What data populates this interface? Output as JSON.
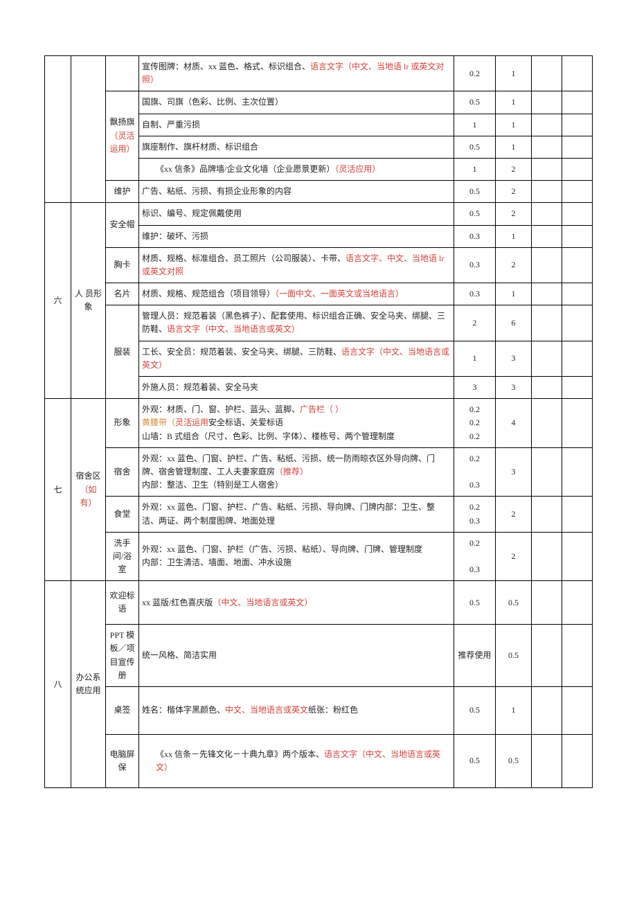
{
  "sec5": {
    "r1": {
      "t1": "宣传图牌：材质、xx 蓝色、格式、标识组合、",
      "t2": "语言文字（中文、当地语 lr 或英文对照）",
      "s1": "0.2",
      "s2": "1"
    },
    "flag_label_a": "飘扬旗",
    "flag_label_b": "（灵活运用）",
    "r2": {
      "desc": "国旗、司旗（色彩、比例、主次位置）",
      "s1": "0.5",
      "s2": "1"
    },
    "r3": {
      "desc": "自制、严重污损",
      "s1": "1",
      "s2": "1"
    },
    "r4": {
      "desc": "旗座制作、旗杆材质、标识组合",
      "s1": "0.5",
      "s2": "1"
    },
    "r5": {
      "t1": "《xx 信条》品牌墙/企业文化墙（企业愿景更新）",
      "t2": "（灵活应用）",
      "s1": "1",
      "s2": "2"
    },
    "r6": {
      "sub": "维护",
      "desc": "广告、粘纸、污损、有损企业形象的内容",
      "s1": "0.5",
      "s2": "2"
    }
  },
  "sec6": {
    "num": "六",
    "cat": "人 员形象",
    "helmet_label": "安全帽",
    "r1": {
      "desc": "标识、编号、规定佩戴使用",
      "s1": "0.5",
      "s2": "2"
    },
    "r2": {
      "desc": "维护：破坏、污损",
      "s1": "0.3",
      "s2": "1"
    },
    "r3": {
      "sub": "胸卡",
      "t1": "材质、规格、标准组合、员工照片（公司服装）、卡带、",
      "t2": "语言文字、中文、当地语 lr 或英文对照",
      "s1": "0.3",
      "s2": "2"
    },
    "r4": {
      "sub": "名片",
      "t1": "材质、规格、规范组合（项目领导）",
      "t2": "（一面中文、一面英文或当地语言）",
      "s1": "0.3",
      "s2": "1"
    },
    "clothing_label": "服装",
    "r5": {
      "t1": "管理人员：规范着装（黑色裤子）、配套使用、标识组合正确、安全马夹、绑腿、三防鞋、",
      "t2": "语言文字（中文、当地语言或英文）",
      "s1": "2",
      "s2": "6"
    },
    "r6": {
      "t1": "工长、安全员：规范着装、安全马夹、绑腿、三防鞋、",
      "t2": "语言文字（中文、当地语言或英文）",
      "s1": "1",
      "s2": "3"
    },
    "r7": {
      "desc": "外施人员：规范着装、安全马夹",
      "s1": "3",
      "s2": "3"
    }
  },
  "sec7": {
    "num": "七",
    "cat_a": "宿舍区",
    "cat_b": "（如有）",
    "r1": {
      "sub": "形象",
      "line1a": "外观：材质、门、窗、护栏、蓝头、蓝脚、",
      "line1b": "广告栏（ ）",
      "line2a": "黄腰带（",
      "line2b": "灵活运用",
      "line2c": "安全标语、关爱标语",
      "line3": "山墙：B 式组合（尺寸、色彩、比例、字体）、楼栋号、两个管理制度",
      "v1": "0.2",
      "v2": "0.2",
      "v3": "0.2",
      "s2": "4"
    },
    "r2": {
      "sub": "宿舍",
      "line1": "外观：xx 蓝色、门窗、护栏、广告、粘纸、污损、统一防雨晾衣区外导向牌、门牌、宿舍管理制度、工人夫妻家庭房",
      "line1b": "（推荐）",
      "line2": "内部：整洁、卫生（特别是工人宿舍）",
      "v1": "0.2",
      "v2": "0.3",
      "s2": "3"
    },
    "r3": {
      "sub": "食堂",
      "desc": "外观：xx 蓝色、门窗、护栏、广告、粘纸、污损、导向牌、门牌内部：卫生、整洁、两证、两个制度图牌、地面处理",
      "v1": "0.2",
      "v2": "0.3",
      "s2": "2"
    },
    "r4": {
      "sub": "洗手间/浴室",
      "line1": "外观：xx 蓝色、门窗、护栏（广告、污损、粘纸）、导向牌、门牌、管理制度",
      "line2": "内部：卫生清洁、墙面、地面、冲水设施",
      "v1": "0.2",
      "v2": "0.3",
      "s2": "2"
    }
  },
  "sec8": {
    "num": "八",
    "cat": "办公系统应用",
    "r1": {
      "sub": "欢迎标语",
      "t1": "xx 蓝版/红色喜庆版",
      "t2": "（中文、当地语言或英文）",
      "s1": "0.5",
      "s2": "0.5"
    },
    "r2": {
      "sub": "PPT 模板／项目宣传册",
      "desc": "统一风格、简洁实用",
      "s1": "推荐使用",
      "s2": "0.5"
    },
    "r3": {
      "sub": "桌签",
      "t1": "姓名：楷体字黑颜色、",
      "t2": "中文、当地语言或英文",
      "t3": "纸张：粉红色",
      "s1": "0.5",
      "s2": "1"
    },
    "r4": {
      "sub": "电脑屏保",
      "t1": "《xx 信条－先锋文化－十典九章》两个版本、",
      "t2": "语言文字（中文、当地语言或英文）",
      "s1": "0.5",
      "s2": "0.5"
    }
  }
}
